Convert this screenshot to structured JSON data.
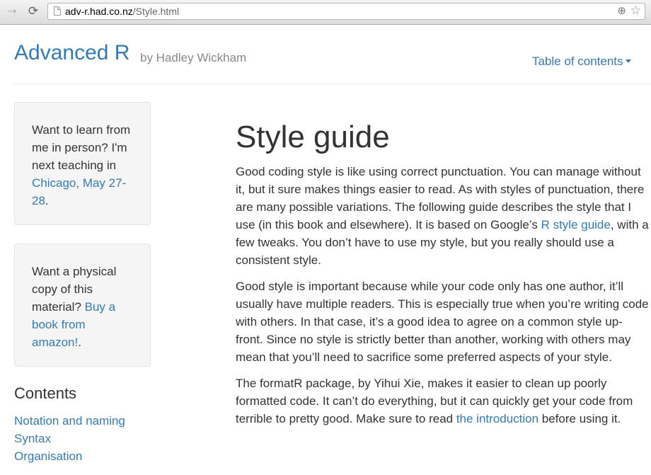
{
  "browser": {
    "back_icon": "back-arrow-icon",
    "reload_icon": "reload-icon",
    "url_host": "adv-r.had.co.nz",
    "url_path": "/Style.html"
  },
  "header": {
    "title": "Advanced R",
    "byline": "by Hadley Wickham",
    "toc": "Table of contents"
  },
  "sidebar": {
    "well1": {
      "text": "Want to learn from me in person? I'm next teaching in ",
      "link": "Chicago, May 27-28",
      "after": "."
    },
    "well2": {
      "text": "Want a physical copy of this material? ",
      "link": "Buy a book from amazon!",
      "after": "."
    },
    "contents_heading": "Contents",
    "contents_links": [
      "Notation and naming",
      "Syntax",
      "Organisation"
    ]
  },
  "main": {
    "title": "Style guide",
    "p1_before": "Good coding style is like using correct punctuation. You can manage without it, but it sure makes things easier to read. As with styles of punctuation, there are many possible variations. The following guide describes the style that I use (in this book and elsewhere). It is based on Google’s ",
    "p1_link": "R style guide",
    "p1_after": ", with a few tweaks. You don’t have to use my style, but you really should use a consistent style.",
    "p2": "Good style is important because while your code only has one author, it’ll usually have multiple readers. This is especially true when you’re writing code with others. In that case, it’s a good idea to agree on a common style up-front. Since no style is strictly better than another, working with others may mean that you’ll need to sacrifice some preferred aspects of your style.",
    "p3_before": "The formatR package, by Yihui Xie, makes it easier to clean up poorly formatted code. It can’t do everything, but it can quickly get your code from terrible to pretty good. Make sure to read ",
    "p3_link": "the introduction",
    "p3_after": " before using it."
  },
  "colors": {
    "link": "#337ab7",
    "text": "#333333",
    "muted": "#888888",
    "well_bg": "#f5f5f5"
  }
}
